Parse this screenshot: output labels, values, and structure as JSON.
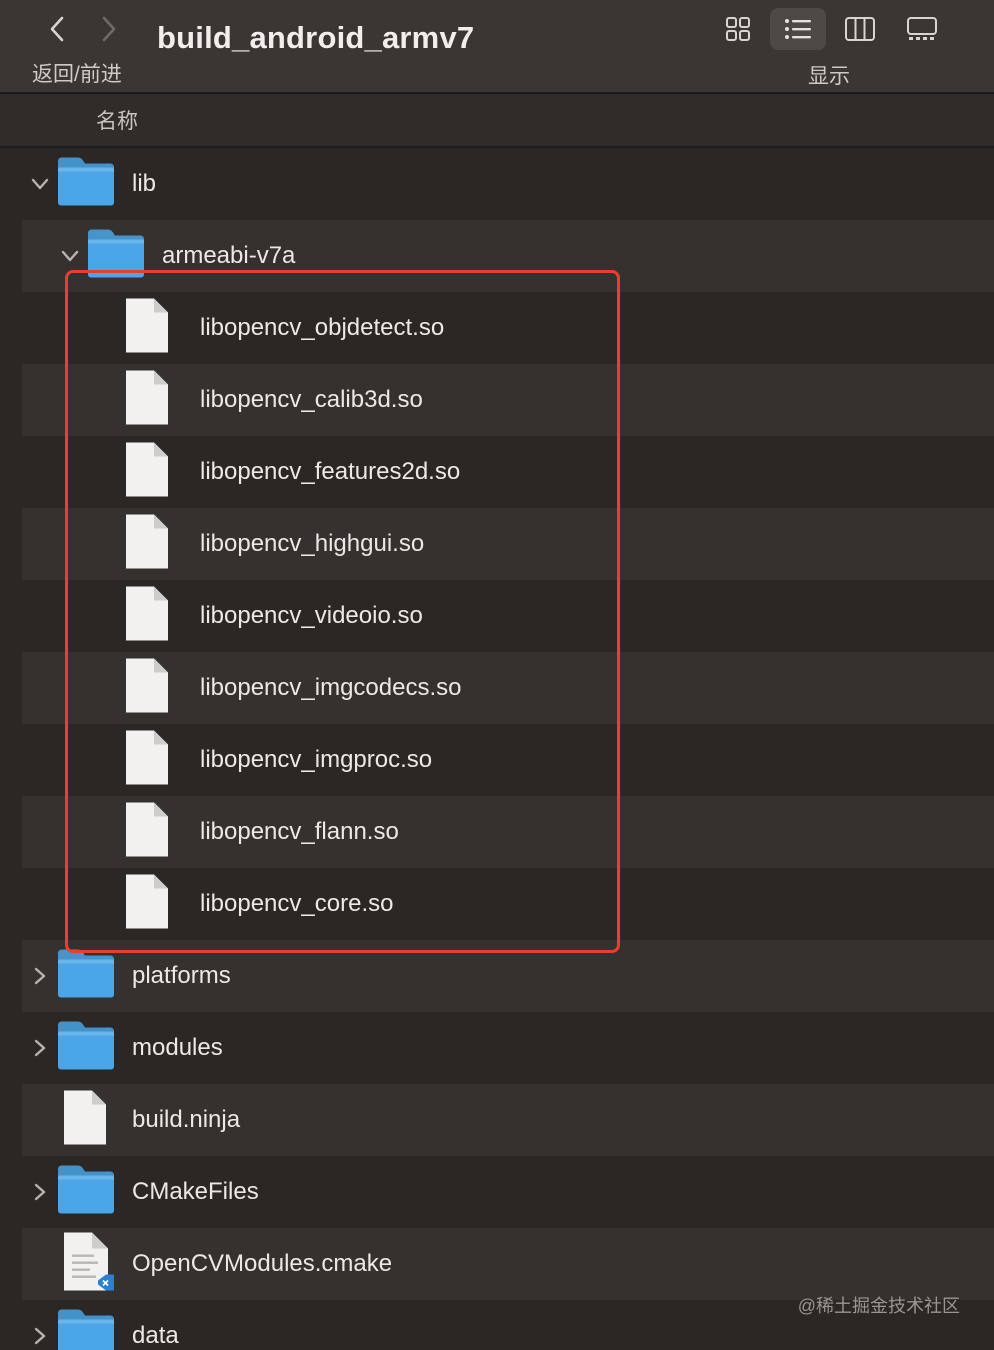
{
  "toolbar": {
    "title": "build_android_armv7",
    "nav_label": "返回/前进",
    "view_label": "显示"
  },
  "header": {
    "name_column": "名称"
  },
  "tree": [
    {
      "label": "lib",
      "type": "folder",
      "expanded": true
    },
    {
      "label": "armeabi-v7a",
      "type": "folder",
      "expanded": true
    },
    {
      "label": "libopencv_objdetect.so",
      "type": "file"
    },
    {
      "label": "libopencv_calib3d.so",
      "type": "file"
    },
    {
      "label": "libopencv_features2d.so",
      "type": "file"
    },
    {
      "label": "libopencv_highgui.so",
      "type": "file"
    },
    {
      "label": "libopencv_videoio.so",
      "type": "file"
    },
    {
      "label": "libopencv_imgcodecs.so",
      "type": "file"
    },
    {
      "label": "libopencv_imgproc.so",
      "type": "file"
    },
    {
      "label": "libopencv_flann.so",
      "type": "file"
    },
    {
      "label": "libopencv_core.so",
      "type": "file"
    },
    {
      "label": "platforms",
      "type": "folder",
      "expanded": false
    },
    {
      "label": "modules",
      "type": "folder",
      "expanded": false
    },
    {
      "label": "build.ninja",
      "type": "file"
    },
    {
      "label": "CMakeFiles",
      "type": "folder",
      "expanded": false
    },
    {
      "label": "OpenCVModules.cmake",
      "type": "cmake-file"
    },
    {
      "label": "data",
      "type": "folder",
      "expanded": false
    }
  ],
  "watermark": "@稀土掘金技术社区",
  "colors": {
    "folder": "#4aa6e8",
    "highlight": "#e8402f",
    "row_alt": "#35312f"
  }
}
